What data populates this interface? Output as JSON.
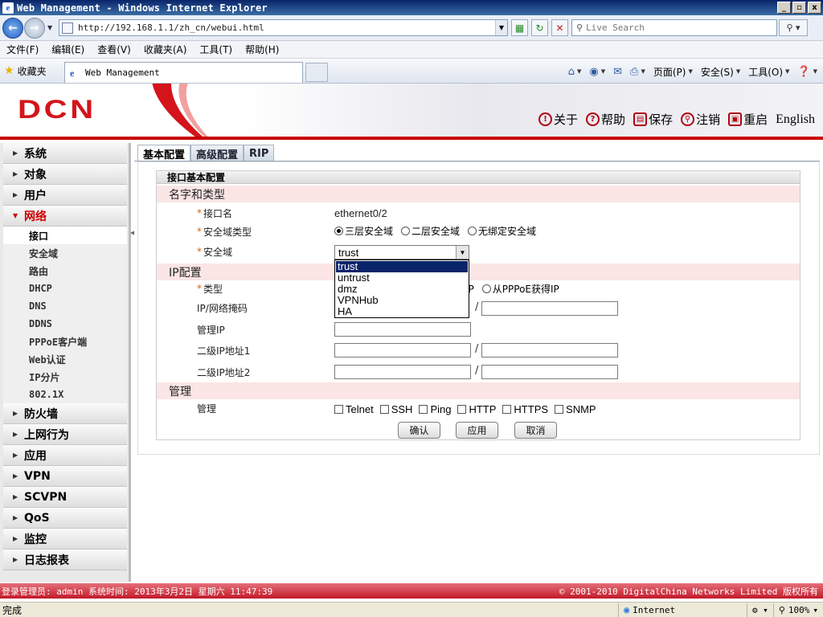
{
  "window": {
    "title": "Web Management - Windows Internet Explorer",
    "controls": [
      "_",
      "▫",
      "x"
    ]
  },
  "address_bar": {
    "url": "http://192.168.1.1/zh_cn/webui.html",
    "search_placeholder": "Live Search"
  },
  "menu": [
    "文件(F)",
    "编辑(E)",
    "查看(V)",
    "收藏夹(A)",
    "工具(T)",
    "帮助(H)"
  ],
  "favorites_bar": {
    "label": "收藏夹",
    "tab_title": "Web Management",
    "commands": [
      "页面(P)",
      "安全(S)",
      "工具(O)"
    ]
  },
  "header": {
    "logo": "DCN",
    "links": [
      {
        "label": "关于",
        "icon": "info-icon"
      },
      {
        "label": "帮助",
        "icon": "help-icon"
      },
      {
        "label": "保存",
        "icon": "save-icon"
      },
      {
        "label": "注销",
        "icon": "key-icon"
      },
      {
        "label": "重启",
        "icon": "restart-icon"
      }
    ],
    "language": "English"
  },
  "sidebar": {
    "groups_before": [
      "系统",
      "对象",
      "用户"
    ],
    "open_group": "网络",
    "sub_items": [
      "接口",
      "安全域",
      "路由",
      "DHCP",
      "DNS",
      "DDNS",
      "PPPoE客户端",
      "Web认证",
      "IP分片",
      "802.1X"
    ],
    "selected_sub": "接口",
    "groups_after": [
      "防火墙",
      "上网行为",
      "应用",
      "VPN",
      "SCVPN",
      "QoS",
      "监控",
      "日志报表"
    ]
  },
  "tabs": [
    "基本配置",
    "高级配置",
    "RIP"
  ],
  "panel": {
    "title": "接口基本配置",
    "section_name_type": "名字和类型",
    "iface_name_label": "接口名",
    "iface_name_value": "ethernet0/2",
    "zone_type_label": "安全域类型",
    "zone_types": [
      "三层安全域",
      "二层安全域",
      "无绑定安全域"
    ],
    "zone_type_selected": "三层安全域",
    "zone_label": "安全域",
    "zone_selected": "trust",
    "zone_options": [
      "trust",
      "untrust",
      "dmz",
      "VPNHub",
      "HA"
    ],
    "section_ip": "IP配置",
    "type_label": "类型",
    "type_options_visible": [
      "获得IP",
      "从PPPoE获得IP"
    ],
    "ip_mask_label": "IP/网络掩码",
    "mgmt_ip_label": "管理IP",
    "secondary_ip1_label": "二级IP地址1",
    "secondary_ip2_label": "二级IP地址2",
    "section_mgmt": "管理",
    "mgmt_label": "管理",
    "mgmt_options": [
      "Telnet",
      "SSH",
      "Ping",
      "HTTP",
      "HTTPS",
      "SNMP"
    ],
    "buttons": {
      "ok": "确认",
      "apply": "应用",
      "cancel": "取消"
    }
  },
  "footer": {
    "left": "登录管理员: admin 系统时间: 2013年3月2日 星期六 11:47:39",
    "right": "© 2001-2010 DigitalChina Networks Limited 版权所有"
  },
  "statusbar": {
    "status": "完成",
    "zone": "Internet",
    "zoom": "100%"
  }
}
